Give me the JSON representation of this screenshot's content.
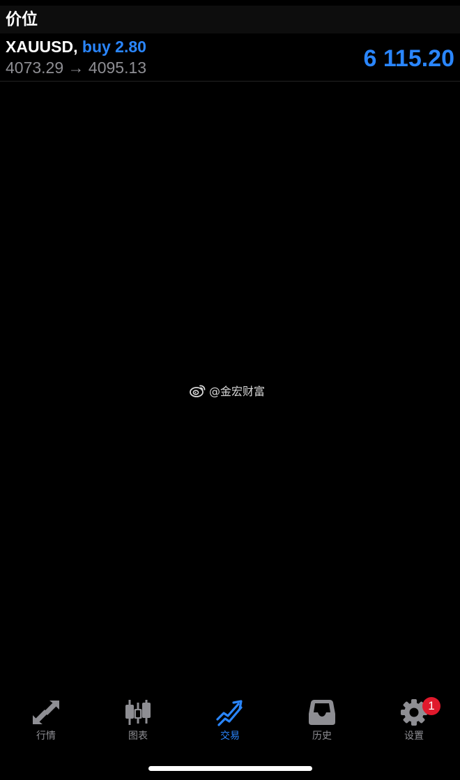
{
  "section": {
    "title": "价位"
  },
  "position": {
    "symbol": "XAUUSD,",
    "side": "buy 2.80",
    "prices": "4073.29 → 4095.13",
    "profit": "6 115.20"
  },
  "watermark": {
    "icon": "weibo-icon",
    "text": "@金宏财富"
  },
  "tabs": [
    {
      "label": "行情",
      "icon": "quotes-arrows-icon",
      "active": false
    },
    {
      "label": "图表",
      "icon": "candlestick-chart-icon",
      "active": false
    },
    {
      "label": "交易",
      "icon": "trade-trend-icon",
      "active": true
    },
    {
      "label": "历史",
      "icon": "history-inbox-icon",
      "active": false
    },
    {
      "label": "设置",
      "icon": "settings-gear-icon",
      "active": false
    }
  ],
  "settings_badge": "1",
  "colors": {
    "accent": "#2a86ff",
    "muted": "#8e8e93",
    "badge": "#e0192c",
    "background": "#000000"
  }
}
